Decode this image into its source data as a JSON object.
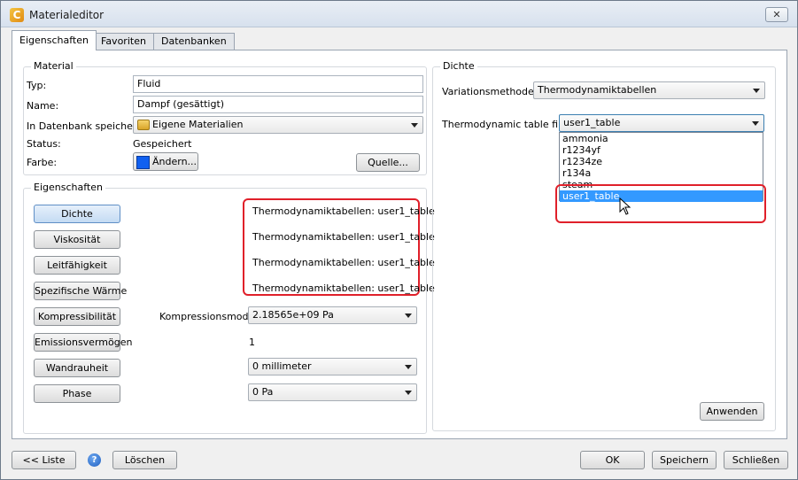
{
  "window": {
    "title": "Materialeditor",
    "close_glyph": "✕"
  },
  "tabs": [
    {
      "label": "Eigenschaften",
      "active": true
    },
    {
      "label": "Favoriten",
      "active": false
    },
    {
      "label": "Datenbanken",
      "active": false
    }
  ],
  "material": {
    "group_title": "Material",
    "type_label": "Typ:",
    "type_value": "Fluid",
    "name_label": "Name:",
    "name_value": "Dampf (gesättigt)",
    "save_db_label": "In Datenbank speichern:",
    "save_db_value": "Eigene Materialien",
    "status_label": "Status:",
    "status_value": "Gespeichert",
    "color_label": "Farbe:",
    "color_button": "Ändern...",
    "color_value": "#1060f0",
    "source_button": "Quelle..."
  },
  "properties": {
    "group_title": "Eigenschaften",
    "buttons": [
      "Dichte",
      "Viskosität",
      "Leitfähigkeit",
      "Spezifische Wärme",
      "Kompressibilität",
      "Emissionsvermögen",
      "Wandrauheit",
      "Phase"
    ],
    "values": [
      "Thermodynamiktabellen:  user1_table",
      "Thermodynamiktabellen:  user1_table",
      "Thermodynamiktabellen:  user1_table",
      "Thermodynamiktabellen:  user1_table"
    ],
    "compress_label": "Kompressionsmodul",
    "compress_value": "2.18565e+09 Pa",
    "emission_value": "1",
    "roughness_value": "0 millimeter",
    "phase_value": "0 Pa"
  },
  "density": {
    "group_title": "Dichte",
    "method_label": "Variationsmethode:",
    "method_value": "Thermodynamiktabellen",
    "table_label": "Thermodynamic table file:",
    "table_value": "user1_table",
    "options": [
      "ammonia",
      "r1234yf",
      "r1234ze",
      "r134a",
      "steam",
      "user1_table"
    ],
    "apply_button": "Anwenden"
  },
  "footer": {
    "list_button": "<< Liste",
    "help_glyph": "?",
    "delete_button": "Löschen",
    "ok_button": "OK",
    "save_button": "Speichern",
    "close_button": "Schließen"
  },
  "colors": {
    "highlight": "#e0202a",
    "selection": "#3399ff",
    "accent_button": "#c4dbf3"
  }
}
